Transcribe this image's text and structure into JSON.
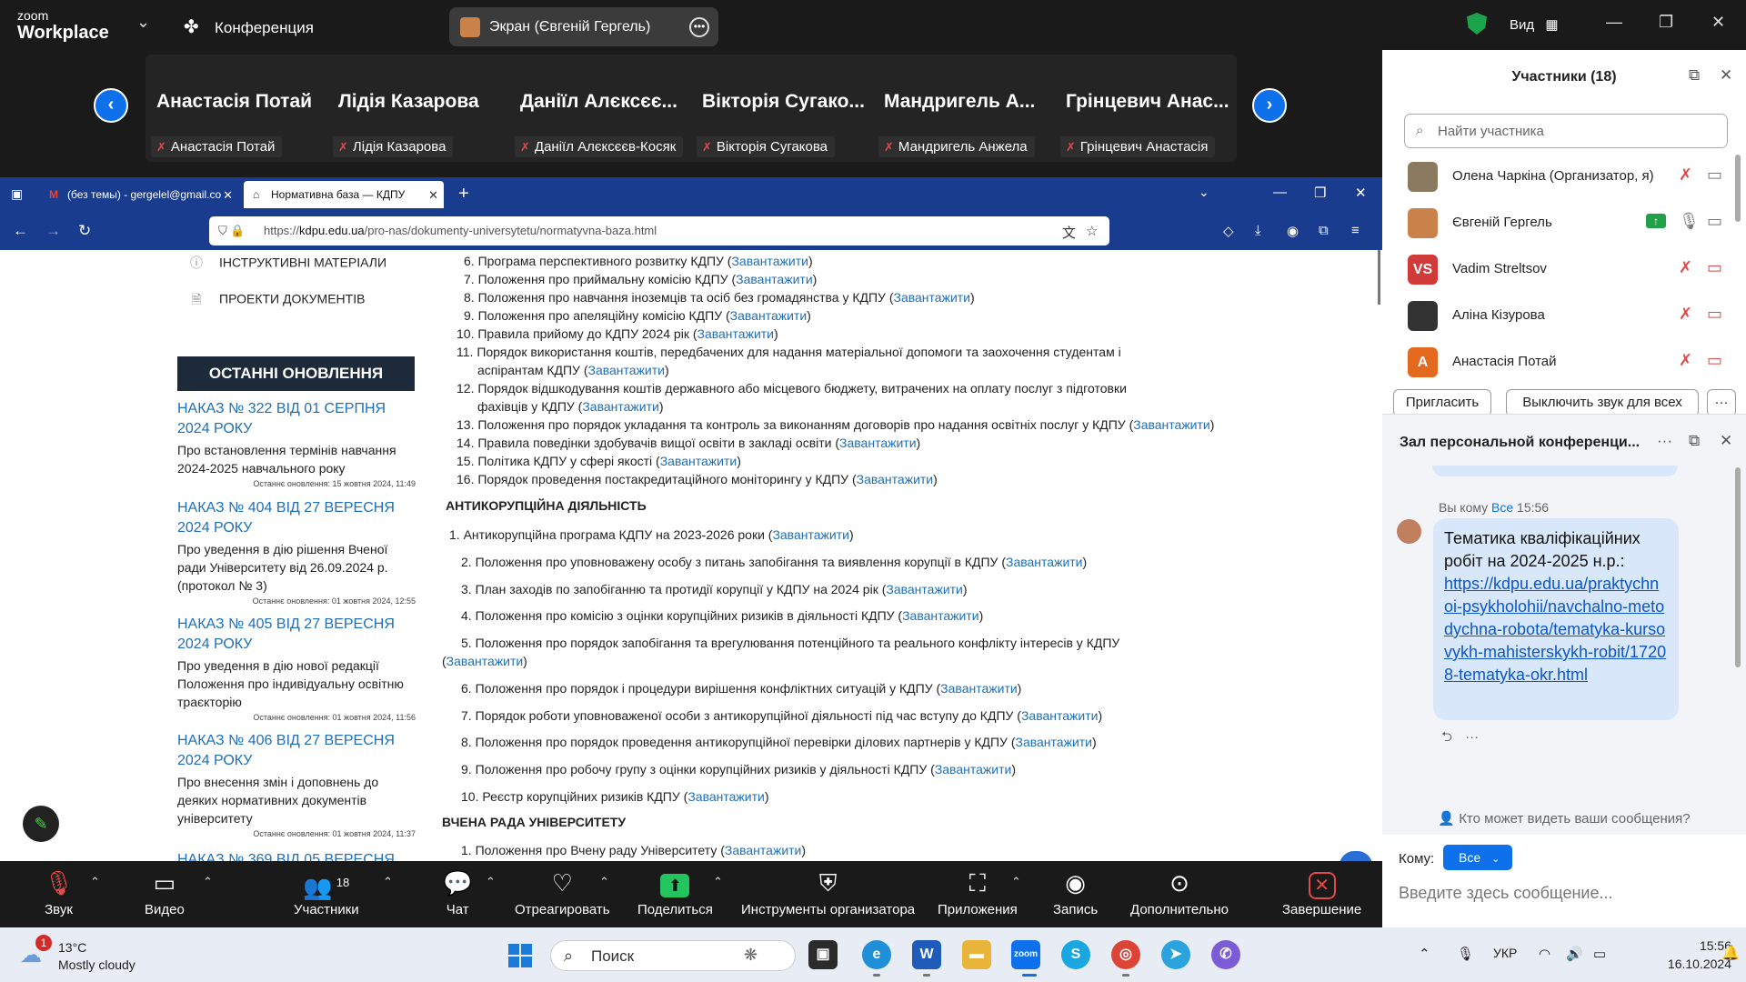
{
  "zoom": {
    "logo_line1": "zoom",
    "logo_line2": "Workplace",
    "meeting_label": "Конференция",
    "share_label": "Экран (Євгеній Гергель)",
    "view_label": "Вид",
    "colors": {
      "accent": "#0e71eb",
      "secure": "#1ca44c",
      "muted": "#e04a4a"
    }
  },
  "gallery": {
    "tiles": [
      {
        "big": "Анастасія Потай",
        "tag": "Анастасія Потай"
      },
      {
        "big": "Лідія Казарова",
        "tag": "Лідія Казарова"
      },
      {
        "big": "Даніїл Алєксєє...",
        "tag": "Даніїл Алєксєєв-Косяк"
      },
      {
        "big": "Вікторія Сугако...",
        "tag": "Вікторія Сугакова"
      },
      {
        "big": "Мандригель А...",
        "tag": "Мандригель Анжела"
      },
      {
        "big": "Грінцевич Анас...",
        "tag": "Грінцевич Анастасія"
      }
    ]
  },
  "browser": {
    "tabs": [
      {
        "title": "(без темы) - gergelel@gmail.co"
      },
      {
        "title": "Нормативна база — КДПУ"
      }
    ],
    "url_prefix": "https://",
    "url_host": "kdpu.edu.ua",
    "url_path": "/pro-nas/dokumenty-universytetu/normatyvna-baza.html"
  },
  "page": {
    "left_menu": [
      "ІНСТРУКТИВНІ МАТЕРІАЛИ",
      "ПРОЕКТИ ДОКУМЕНТІВ"
    ],
    "updates_heading": "ОСТАННІ ОНОВЛЕННЯ",
    "updates": [
      {
        "title": "НАКАЗ № 322 ВІД 01 СЕРПНЯ 2024 РОКУ",
        "desc": "Про встановлення термінів навчання 2024-2025 навчального року",
        "date": "Останнє оновлення: 15 жовтня 2024, 11:49"
      },
      {
        "title": "НАКАЗ № 404 ВІД 27 ВЕРЕСНЯ 2024 РОКУ",
        "desc": "Про уведення в дію рішення Вченої ради Університету від 26.09.2024 р. (протокол № 3)",
        "date": "Останнє оновлення: 01 жовтня 2024, 12:55"
      },
      {
        "title": "НАКАЗ № 405 ВІД 27 ВЕРЕСНЯ 2024 РОКУ",
        "desc": "Про уведення в дію нової редакції Положення про індивідуальну освітню траєкторію",
        "date": "Останнє оновлення: 01 жовтня 2024, 11:56"
      },
      {
        "title": "НАКАЗ № 406 ВІД 27 ВЕРЕСНЯ 2024 РОКУ",
        "desc": "Про внесення змін і доповнень до деяких нормативних документів університету",
        "date": "Останнє оновлення: 01 жовтня 2024, 11:37"
      }
    ],
    "left_cut": "НАКАЗ № 369 ВІД 05 ВЕРЕСНЯ",
    "download": "Завантажити",
    "list1": [
      "6. Програма перспективного розвитку КДПУ (",
      "7. Положення про приймальну комісію КДПУ (",
      "8. Положення про навчання іноземців та осіб без громадянства у КДПУ (",
      "9. Положення про апеляційну комісію КДПУ (",
      "10. Правила прийому до КДПУ 2024 рік (",
      "11. Порядок використання коштів, передбачених для надання матеріальної допомоги та заохочення студентам і",
      "аспірантам КДПУ (",
      "12. Порядок відшкодування коштів державного або місцевого бюджету, витрачених на оплату послуг з підготовки",
      "фахівців у КДПУ (",
      "13. Положення про порядок укладання та контроль за виконанням договорів про надання освітніх послуг у КДПУ (",
      "14. Правила поведінки здобувачів вищої освіти в закладі освіти (",
      "15. Політика КДПУ у сфері якості (",
      "16. Порядок проведення постакредитаційного моніторингу у КДПУ ("
    ],
    "section2": "АНТИКОРУПЦІЙНА ДІЯЛЬНІСТЬ",
    "list2": [
      "1. Антикорупційна програма КДПУ на 2023-2026 роки (",
      "2.  Положення про уповноважену особу з питань запобігання та виявлення корупції в КДПУ (",
      "3. План заходів по запобіганню та протидії корупції у КДПУ на 2024 рік (",
      "4. Положення про комісію з оцінки корупційних ризиків в діяльності КДПУ (",
      "5. Положення про порядок запобігання та врегулювання потенційного та реального конфлікту інтересів у КДПУ",
      "6. Положення про порядок і процедури вирішення конфліктних ситуацій у КДПУ (",
      "7. Порядок роботи уповноваженої особи з антикорупційної діяльності під час вступу до КДПУ (",
      "8. Положення про порядок проведення антикорупційної перевірки ділових партнерів у КДПУ (",
      "9. Положення про робочу групу з оцінки корупційних ризиків у діяльності КДПУ (",
      "10. Реєстр корупційних ризиків КДПУ ("
    ],
    "section3": "ВЧЕНА РАДА УНІВЕРСИТЕТУ",
    "list3": [
      "1. Положення про Вчену раду Університету ("
    ]
  },
  "participants": {
    "title": "Участники (18)",
    "search_placeholder": "Найти участника",
    "rows": [
      {
        "name": "Олена Чаркіна (Организатор, я)",
        "initials": "",
        "color": "#8a7a60"
      },
      {
        "name": "Євгеній Гергель",
        "initials": "",
        "color": "#c9834a"
      },
      {
        "name": "Vadim Streltsov",
        "initials": "VS",
        "color": "#d23a3a"
      },
      {
        "name": "Аліна Кізурова",
        "initials": "",
        "color": "#333333"
      },
      {
        "name": "Анастасія Потай",
        "initials": "А",
        "color": "#e2691e"
      }
    ],
    "invite": "Пригласить",
    "mute_all": "Выключить звук для всех"
  },
  "chat": {
    "title": "Зал персональной конференци...",
    "meta_prefix": "Вы кому ",
    "meta_to": "Все",
    "meta_time": "15:56",
    "message_text": "Тематика кваліфікаційних робіт на 2024-2025 н.р.:",
    "message_link": "https://kdpu.edu.ua/praktychnoi-psykholohii/navchalno-metodychna-robota/tematyka-kursovykh-mahisterskykh-robit/17208-tematyka-okr.html",
    "who_can_see": "Кто может видеть ваши сообщения?",
    "to_label": "Кому:",
    "to_value": "Все",
    "input_placeholder": "Введите здесь сообщение..."
  },
  "toolbar": {
    "audio": "Звук",
    "video": "Видео",
    "participants": "Участники",
    "participants_count": "18",
    "chat": "Чат",
    "react": "Отреагировать",
    "share": "Поделиться",
    "host_tools": "Инструменты организатора",
    "apps": "Приложения",
    "record": "Запись",
    "more": "Дополнительно",
    "end": "Завершение"
  },
  "taskbar": {
    "temp": "13°C",
    "weather": "Mostly cloudy",
    "weather_badge": "1",
    "search": "Поиск",
    "lang": "УКР",
    "time": "15:56",
    "date": "16.10.2024"
  }
}
